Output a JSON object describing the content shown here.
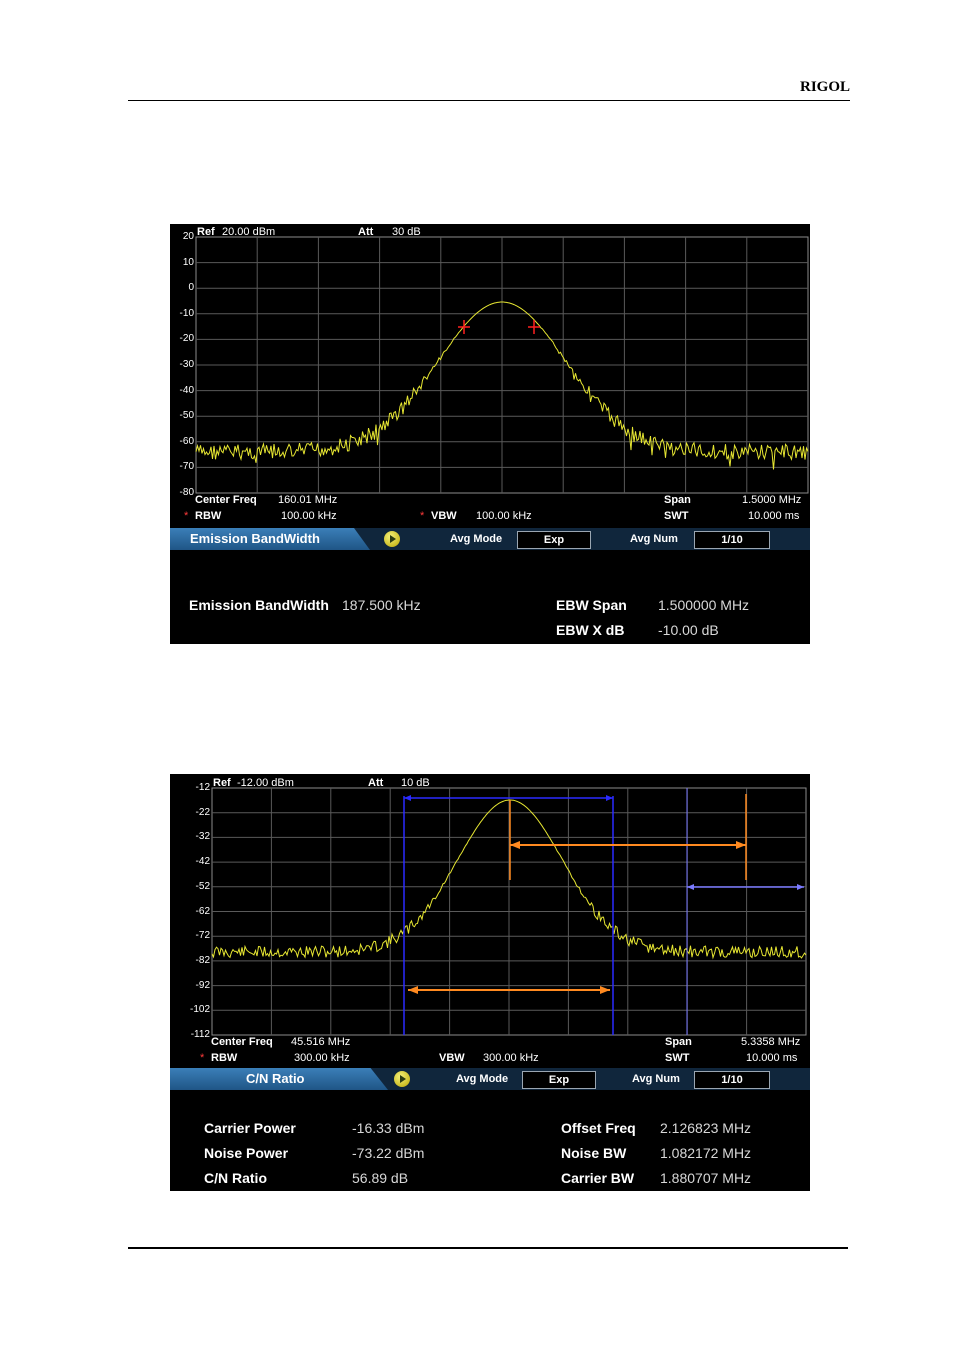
{
  "header": {
    "brand": "RIGOL"
  },
  "screen1": {
    "ref_label": "Ref",
    "ref_value": "20.00 dBm",
    "att_label": "Att",
    "att_value": "30 dB",
    "y_ticks": [
      "20",
      "10",
      "0",
      "-10",
      "-20",
      "-30",
      "-40",
      "-50",
      "-60",
      "-70",
      "-80"
    ],
    "center_freq_label": "Center Freq",
    "center_freq_value": "160.01 MHz",
    "span_label": "Span",
    "span_value": "1.5000 MHz",
    "rbw_label": "RBW",
    "rbw_value": "100.00 kHz",
    "vbw_label": "VBW",
    "vbw_value": "100.00 kHz",
    "swt_label": "SWT",
    "swt_value": "10.000 ms",
    "asterisk": "*",
    "toolbar": {
      "title": "Emission BandWidth",
      "avg_mode_label": "Avg Mode",
      "avg_mode_value": "Exp",
      "avg_num_label": "Avg Num",
      "avg_num_value": "1/10"
    },
    "results": {
      "ebw_label": "Emission BandWidth",
      "ebw_value": "187.500 kHz",
      "ebw_span_label": "EBW Span",
      "ebw_span_value": "1.500000 MHz",
      "ebw_xdb_label": "EBW X dB",
      "ebw_xdb_value": "-10.00 dB"
    },
    "colors": {
      "trace": "#e6e632",
      "marker": "#ff2020",
      "grid": "#5a5a5a"
    }
  },
  "screen2": {
    "ref_label": "Ref",
    "ref_value": "-12.00 dBm",
    "att_label": "Att",
    "att_value": "10 dB",
    "y_ticks": [
      "-12",
      "-22",
      "-32",
      "-42",
      "-52",
      "-62",
      "-72",
      "-82",
      "-92",
      "-102",
      "-112"
    ],
    "center_freq_label": "Center Freq",
    "center_freq_value": "45.516 MHz",
    "span_label": "Span",
    "span_value": "5.3358 MHz",
    "rbw_label": "RBW",
    "rbw_value": "300.00 kHz",
    "vbw_label": "VBW",
    "vbw_value": "300.00 kHz",
    "swt_label": "SWT",
    "swt_value": "10.000 ms",
    "asterisk": "*",
    "toolbar": {
      "title": "C/N Ratio",
      "avg_mode_label": "Avg Mode",
      "avg_mode_value": "Exp",
      "avg_num_label": "Avg Num",
      "avg_num_value": "1/10"
    },
    "results": {
      "carrier_power_label": "Carrier Power",
      "carrier_power_value": "-16.33 dBm",
      "noise_power_label": "Noise Power",
      "noise_power_value": "-73.22 dBm",
      "cn_ratio_label": "C/N Ratio",
      "cn_ratio_value": "56.89 dB",
      "offset_freq_label": "Offset Freq",
      "offset_freq_value": "2.126823 MHz",
      "noise_bw_label": "Noise BW",
      "noise_bw_value": "1.082172 MHz",
      "carrier_bw_label": "Carrier BW",
      "carrier_bw_value": "1.880707 MHz"
    },
    "colors": {
      "trace": "#e6e632",
      "carrier_band": "#2a2aff",
      "noise_band": "#7a7aff",
      "arrow": "#ff8a20",
      "grid": "#5a5a5a"
    }
  }
}
